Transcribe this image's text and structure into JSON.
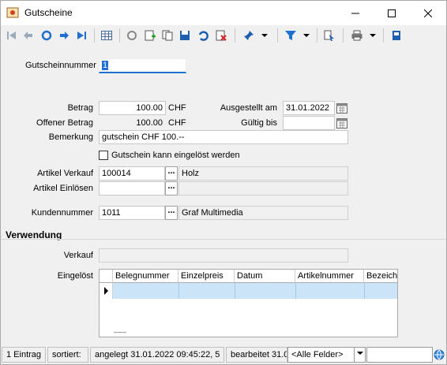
{
  "window": {
    "title": "Gutscheine"
  },
  "form": {
    "gutscheinnummer_label": "Gutscheinnummer",
    "gutscheinnummer_value": "1",
    "betrag_label": "Betrag",
    "betrag_value": "100.00",
    "betrag_currency": "CHF",
    "offen_label": "Offener Betrag",
    "offen_value": "100.00",
    "offen_currency": "CHF",
    "bemerkung_label": "Bemerkung",
    "bemerkung_value": "gutschein CHF 100.--",
    "ausgestellt_label": "Ausgestellt am",
    "ausgestellt_value": "31.01.2022",
    "gueltig_label": "Gültig bis",
    "gueltig_value": "",
    "checkbox_label": "Gutschein kann eingelöst werden",
    "checkbox_checked": false,
    "artikel_verkauf_label": "Artikel Verkauf",
    "artikel_verkauf_value": "100014",
    "artikel_verkauf_desc": "Holz",
    "artikel_einloesen_label": "Artikel Einlösen",
    "artikel_einloesen_value": "",
    "artikel_einloesen_desc": "",
    "kundennummer_label": "Kundennummer",
    "kundennummer_value": "1011",
    "kundennummer_desc": "Graf Multimedia",
    "lookup_button": "..."
  },
  "verwendung": {
    "section_title": "Verwendung",
    "verkauf_label": "Verkauf",
    "verkauf_value": "",
    "eingeloest_label": "Eingelöst",
    "columns": [
      "Belegnummer",
      "Einzelpreis",
      "Datum",
      "Artikelnummer",
      "Bezeich"
    ]
  },
  "status": {
    "count": "1 Eintrag",
    "sorted": "sortiert:",
    "created": "angelegt 31.01.2022 09:45:22,  5",
    "edited": "bearbeitet 31.0",
    "filter_value": "<Alle Felder>",
    "search_value": ""
  },
  "colors": {
    "accent_blue": "#1e6fd0",
    "selection": "#cce4f7",
    "danger": "#d32020",
    "green": "#2a9a2a",
    "yellow": "#f0c020"
  }
}
